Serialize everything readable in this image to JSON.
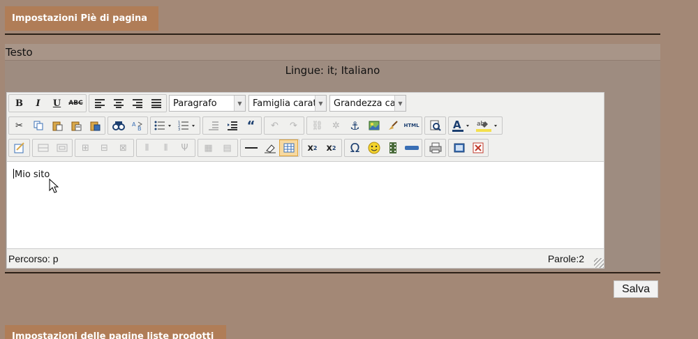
{
  "sections": {
    "footer_settings": "Impostazioni Piè di pagina",
    "product_list_settings": "Impostazioni delle pagine liste prodotti"
  },
  "panel": {
    "title": "Testo",
    "language": "Lingue: it; Italiano"
  },
  "editor": {
    "format_select": "Paragrafo",
    "font_family_select": "Famiglia caratt",
    "font_size_select": "Grandezza car",
    "content": "Mio sito",
    "status_path": "Percorso: p",
    "status_words": "Parole:2"
  },
  "actions": {
    "save_label": "Salva"
  },
  "icons": {
    "bold": "B",
    "italic": "I",
    "underline": "U",
    "strike": "ABC",
    "html": "HTML",
    "omega": "Ω",
    "smiley": "☺",
    "quote": "“"
  },
  "colors": {
    "background": "#a38876",
    "section_tab": "#b07d57",
    "panel": "#9e8c80"
  }
}
